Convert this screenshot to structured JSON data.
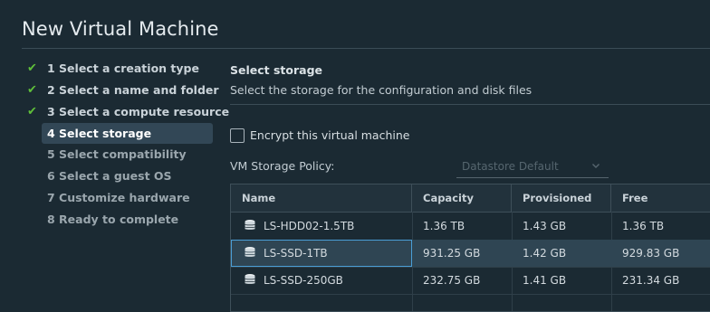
{
  "dialog": {
    "title": "New Virtual Machine"
  },
  "steps": [
    {
      "label": "1 Select a creation type",
      "state": "done"
    },
    {
      "label": "2 Select a name and folder",
      "state": "done"
    },
    {
      "label": "3 Select a compute resource",
      "state": "done"
    },
    {
      "label": "4 Select storage",
      "state": "active"
    },
    {
      "label": "5 Select compatibility",
      "state": "future"
    },
    {
      "label": "6 Select a guest OS",
      "state": "future"
    },
    {
      "label": "7 Customize hardware",
      "state": "future"
    },
    {
      "label": "8 Ready to complete",
      "state": "future"
    }
  ],
  "storage": {
    "title": "Select storage",
    "subtitle": "Select the storage for the configuration and disk files",
    "encrypt_label": "Encrypt this virtual machine",
    "encrypt_checked": false,
    "policy_label": "VM Storage Policy:",
    "policy_value": "Datastore Default"
  },
  "table": {
    "columns": [
      "Name",
      "Capacity",
      "Provisioned",
      "Free"
    ],
    "rows": [
      {
        "name": "LS-HDD02-1.5TB",
        "capacity": "1.36 TB",
        "provisioned": "1.43 GB",
        "free": "1.36 TB",
        "selected": false
      },
      {
        "name": "LS-SSD-1TB",
        "capacity": "931.25 GB",
        "provisioned": "1.42 GB",
        "free": "929.83 GB",
        "selected": true
      },
      {
        "name": "LS-SSD-250GB",
        "capacity": "232.75 GB",
        "provisioned": "1.41 GB",
        "free": "231.34 GB",
        "selected": false
      }
    ]
  },
  "icons": {
    "step_done": "check-icon",
    "datastore": "database-icon",
    "dropdown": "chevron-down-icon"
  },
  "colors": {
    "background": "#1b2a33",
    "check": "#5fbf3a",
    "active_step": "#324756",
    "selection_outline": "#4a9ed6"
  }
}
